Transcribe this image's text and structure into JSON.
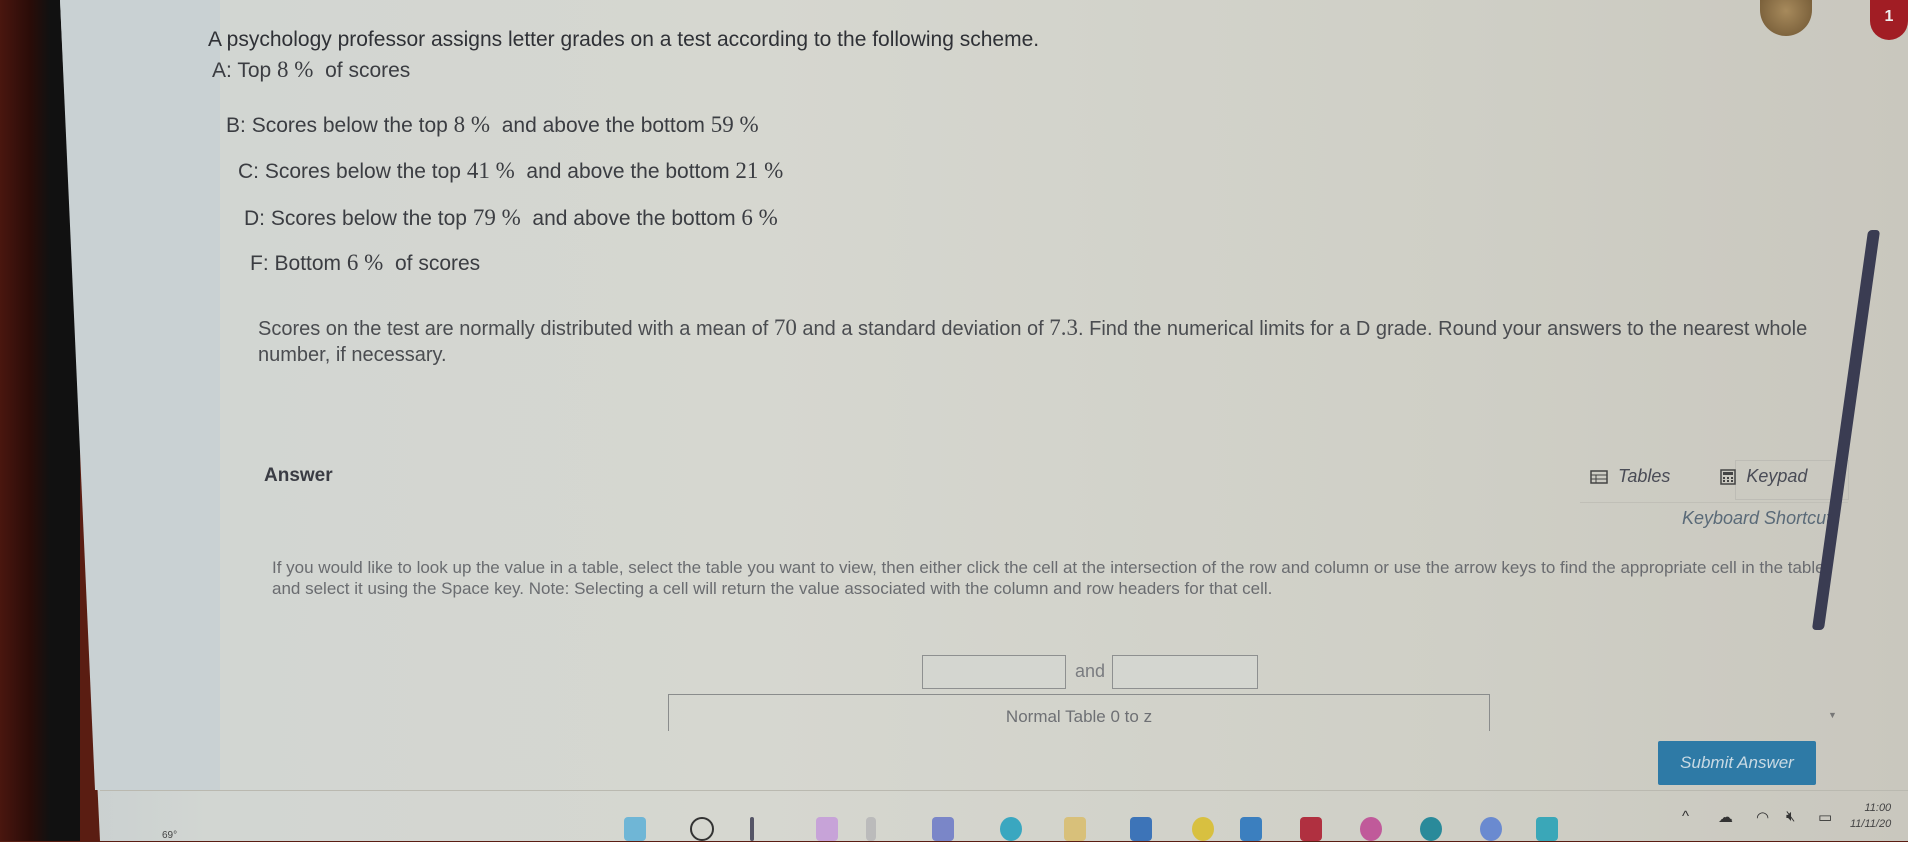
{
  "question": {
    "title": "A psychology professor assigns letter grades on a test according to the following scheme.",
    "grades": [
      {
        "letter": "A:",
        "pre": "Top",
        "n1": "8 %",
        "mid": "of scores",
        "n2": "",
        "post": ""
      },
      {
        "letter": "B:",
        "pre": "Scores below the top",
        "n1": "8 %",
        "mid": "and above the bottom",
        "n2": "59 %",
        "post": ""
      },
      {
        "letter": "C:",
        "pre": "Scores below the top",
        "n1": "41 %",
        "mid": "and above the bottom",
        "n2": "21 %",
        "post": ""
      },
      {
        "letter": "D:",
        "pre": "Scores below the top",
        "n1": "79 %",
        "mid": "and above the bottom",
        "n2": "6 %",
        "post": ""
      },
      {
        "letter": "F:",
        "pre": "Bottom",
        "n1": "6 %",
        "mid": "of scores",
        "n2": "",
        "post": ""
      }
    ],
    "body_pre": "Scores on the test are normally distributed with a mean of",
    "mean": "70",
    "body_mid": "and a standard deviation of",
    "sd": "7.3",
    "body_post": ". Find the numerical limits for a D grade. Round your answers to the nearest whole number, if necessary."
  },
  "answer": {
    "label": "Answer",
    "tables_label": "Tables",
    "keypad_label": "Keypad",
    "keyboard_shortcuts": "Keyboard Shortcuts",
    "instructions": "If you would like to look up the value in a table, select the table you want to view, then either click the cell at the intersection of the row and column or use the arrow keys to find the appropriate cell in the table and select it using the Space key. Note: Selecting a cell will return the value associated with the column and row headers for that cell.",
    "input1_value": "",
    "and_label": "and",
    "input2_value": "",
    "table_select": "Normal Table 0 to z",
    "submit_label": "Submit Answer"
  },
  "header": {
    "notification_count": "1"
  },
  "taskbar": {
    "weather": "69°",
    "time": "11:00",
    "date": "11/11/20"
  },
  "colors": {
    "submit_bg": "#2e7aa6",
    "badge_bg": "#a11d24"
  }
}
